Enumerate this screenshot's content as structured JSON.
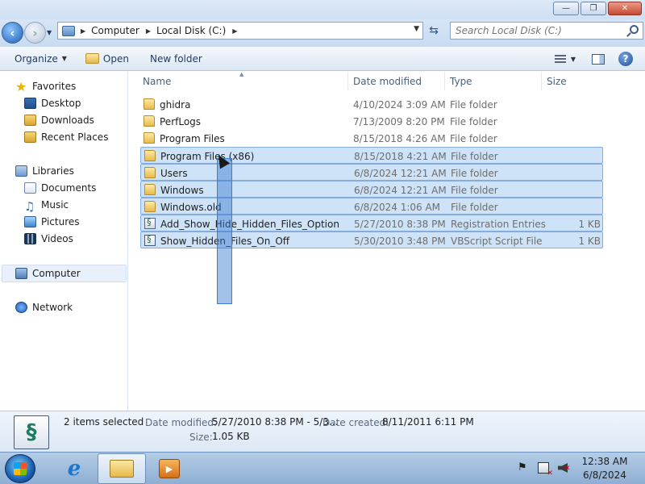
{
  "window": {
    "minimize_label": "—",
    "maximize_label": "❐",
    "close_label": "✕"
  },
  "address": {
    "crumbs": [
      "Computer",
      "Local Disk (C:)"
    ],
    "search_placeholder": "Search Local Disk (C:)"
  },
  "toolbar": {
    "organize_label": "Organize",
    "open_label": "Open",
    "new_folder_label": "New folder",
    "help_label": "?"
  },
  "navpane": {
    "favorites_label": "Favorites",
    "favorites": [
      "Desktop",
      "Downloads",
      "Recent Places"
    ],
    "libraries_label": "Libraries",
    "libraries": [
      "Documents",
      "Music",
      "Pictures",
      "Videos"
    ],
    "computer_label": "Computer",
    "network_label": "Network"
  },
  "columns": {
    "name": "Name",
    "date_modified": "Date modified",
    "type": "Type",
    "size": "Size"
  },
  "files": [
    {
      "name": "ghidra",
      "date": "4/10/2024 3:09 AM",
      "type": "File folder",
      "size": "",
      "icon": "folder-icon",
      "selected": false
    },
    {
      "name": "PerfLogs",
      "date": "7/13/2009 8:20 PM",
      "type": "File folder",
      "size": "",
      "icon": "folder-icon",
      "selected": false
    },
    {
      "name": "Program Files",
      "date": "8/15/2018 4:26 AM",
      "type": "File folder",
      "size": "",
      "icon": "folder-icon",
      "selected": false
    },
    {
      "name": "Program Files (x86)",
      "date": "8/15/2018 4:21 AM",
      "type": "File folder",
      "size": "",
      "icon": "folder-icon",
      "selected": true
    },
    {
      "name": "Users",
      "date": "6/8/2024 12:21 AM",
      "type": "File folder",
      "size": "",
      "icon": "folder-icon",
      "selected": true
    },
    {
      "name": "Windows",
      "date": "6/8/2024 12:21 AM",
      "type": "File folder",
      "size": "",
      "icon": "folder-icon",
      "selected": true
    },
    {
      "name": "Windows.old",
      "date": "6/8/2024 1:06 AM",
      "type": "File folder",
      "size": "",
      "icon": "folder-icon",
      "selected": true
    },
    {
      "name": "Add_Show_Hide_Hidden_Files_Option",
      "date": "5/27/2010 8:38 PM",
      "type": "Registration Entries",
      "size": "1 KB",
      "icon": "registry-file-icon",
      "selected": true
    },
    {
      "name": "Show_Hidden_Files_On_Off",
      "date": "5/30/2010 3:48 PM",
      "type": "VBScript Script File",
      "size": "1 KB",
      "icon": "vbscript-file-icon",
      "selected": true
    }
  ],
  "details": {
    "selection": "2 items selected",
    "date_modified_label": "Date modified:",
    "date_modified_value": "5/27/2010 8:38 PM - 5/3...",
    "date_created_label": "Date created:",
    "date_created_value": "8/11/2011 6:11 PM",
    "size_label": "Size:",
    "size_value": "1.05 KB"
  },
  "taskbar": {
    "time": "12:38 AM",
    "date": "6/8/2024"
  },
  "colors": {
    "selection_fill": "#cfe3f8",
    "selection_border": "#84acdd",
    "marquee": "#3f7cc9"
  }
}
